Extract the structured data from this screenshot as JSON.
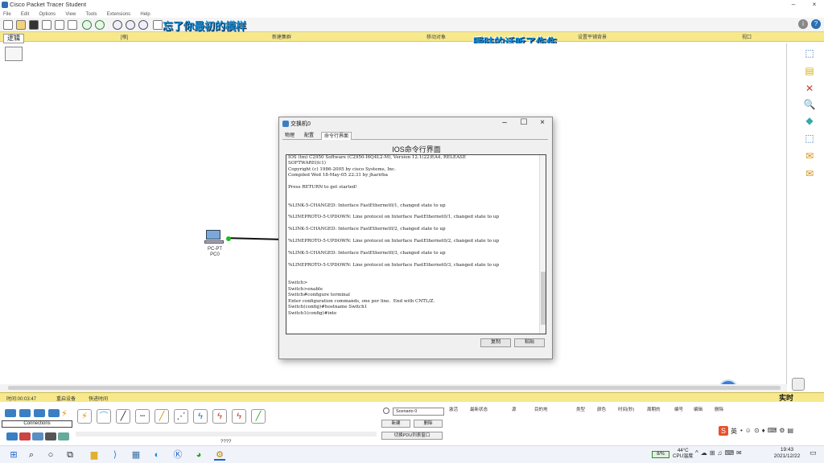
{
  "window": {
    "title": "Cisco Packet Tracer Student",
    "minimize": "–",
    "close": "×"
  },
  "menubar": [
    "File",
    "Edit",
    "Options",
    "View",
    "Tools",
    "Extensions",
    "Help"
  ],
  "overlays": {
    "top_text": "忘了你最初的模样",
    "right_text": "暧昧的话听了伤伤"
  },
  "workspace_bar": {
    "logic_tab": "逻辑",
    "root": "[根]",
    "new_cluster": "新建集群",
    "move_object": "移动对象",
    "set_tiled_bg": "设置平铺背景",
    "viewport": "视口"
  },
  "pc": {
    "model": "PC-PT",
    "name": "PC0"
  },
  "dialog": {
    "title": "交换机0",
    "tabs": [
      "物理",
      "配置",
      "命令行界面"
    ],
    "active_tab": 2,
    "heading": "IOS命令行界面",
    "terminal_lines": [
      "IOS (tm) C2950 Software (C2950-I6Q4L2-M), Version 12.1(22)EA4, RELEASE",
      "SOFTWARE(fc1)",
      "Copyright (c) 1986-2005 by cisco Systems, Inc.",
      "Compiled Wed 18-May-05 22:31 by jharirba",
      "",
      "Press RETURN to get started!",
      "",
      "",
      "%LINK-5-CHANGED: Interface FastEthernet0/1, changed state to up",
      "",
      "%LINEPROTO-5-UPDOWN: Line protocol on Interface FastEthernet0/1, changed state to up",
      "",
      "%LINK-5-CHANGED: Interface FastEthernet0/2, changed state to up",
      "",
      "%LINEPROTO-5-UPDOWN: Line protocol on Interface FastEthernet0/2, changed state to up",
      "",
      "%LINK-5-CHANGED: Interface FastEthernet0/3, changed state to up",
      "",
      "%LINEPROTO-5-UPDOWN: Line protocol on Interface FastEthernet0/3, changed state to up",
      "",
      "",
      "Switch>",
      "Switch>enable",
      "Switch#configure terminal",
      "Enter configuration commands, one per line.  End with CNTL/Z.",
      "Switch(config)#hostname Switch1",
      "Switch1(config)#inte"
    ],
    "copy_button": "复制",
    "paste_button": "粘贴"
  },
  "timeline": {
    "time_label": "时间:00:03:47",
    "power_cycle": "重启设备",
    "fast_forward": "快进时间",
    "mode": "实时"
  },
  "bottom": {
    "connections_label": "Connections",
    "scenario": "Scenario 0",
    "new_btn": "新建",
    "delete_btn": "删除",
    "toggle_pdu": "切换PDU列表窗口",
    "pdu_columns": [
      "激活",
      "最新状态",
      "源",
      "目的地",
      "类型",
      "颜色",
      "时间(秒)",
      "周期的",
      "编号",
      "编辑",
      "删除"
    ],
    "status_text": "????"
  },
  "taskbar": {
    "battery": "8/%",
    "temperature": "44°C",
    "cpu_label": "CPU温度",
    "time": "19:43",
    "date": "2021/12/22",
    "ime": "英"
  },
  "colors": {
    "yellow_bar": "#f7e98b",
    "overlay_blue": "#1a8fd8",
    "link_green": "#1dbb1d"
  }
}
